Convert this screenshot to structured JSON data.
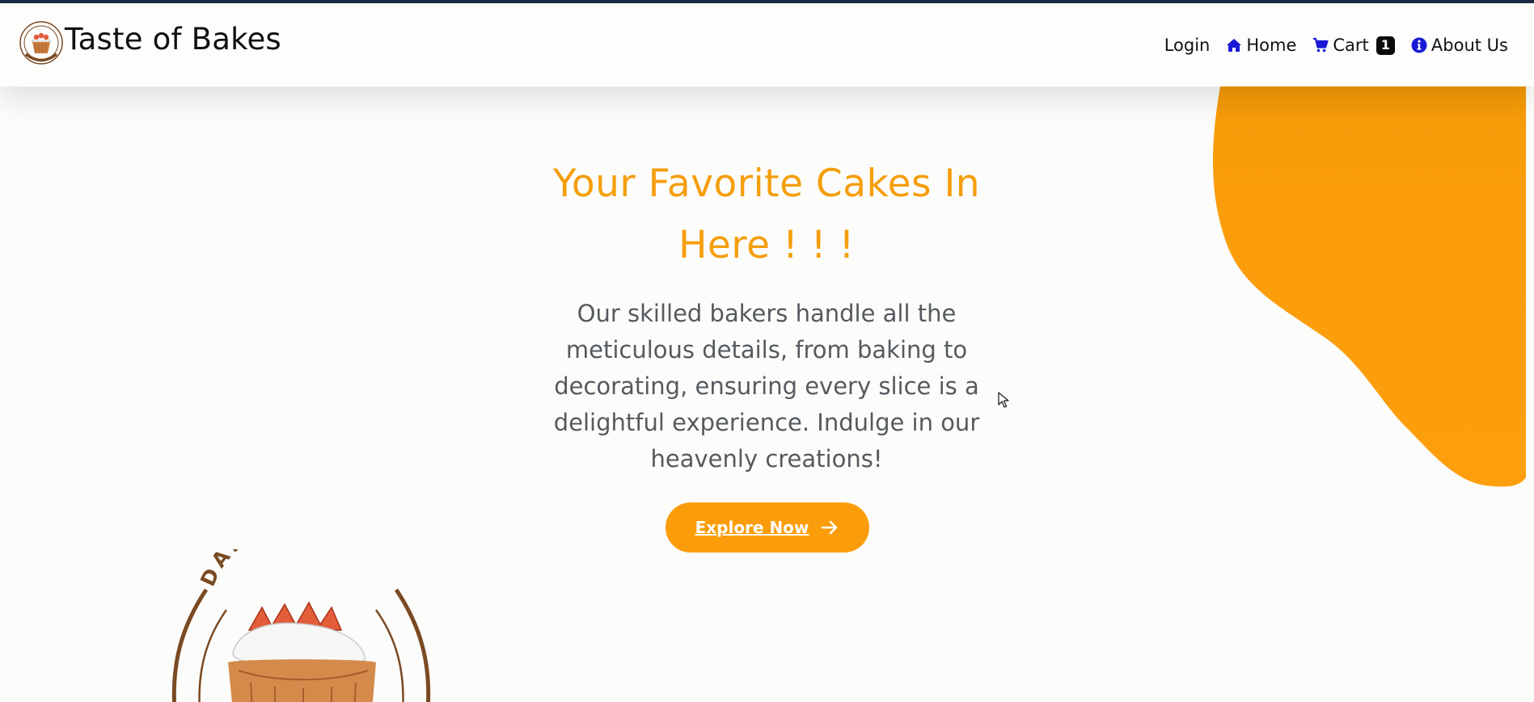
{
  "brand": {
    "name": "Taste of Bakes",
    "logo_icon": "bakery-logo-icon"
  },
  "nav": {
    "login": "Login",
    "home": "Home",
    "cart": "Cart",
    "cart_count": "1",
    "about": "About Us",
    "icons": {
      "home": "home-icon",
      "cart": "cart-icon",
      "about": "info-icon"
    }
  },
  "hero": {
    "title": "Your Favorite Cakes In Here ! ! !",
    "description": "Our skilled bakers handle all the meticulous details, from baking to decorating, ensuring every slice is a delightful experience. Indulge in our heavenly creations!",
    "cta": "Explore Now"
  },
  "badge": {
    "text": "DAILY FRESH"
  },
  "colors": {
    "accent": "#f59e0b",
    "button": "#fb9d0b",
    "nav_icon": "#1a1ad6",
    "top_stripe": "#1b2b45"
  }
}
